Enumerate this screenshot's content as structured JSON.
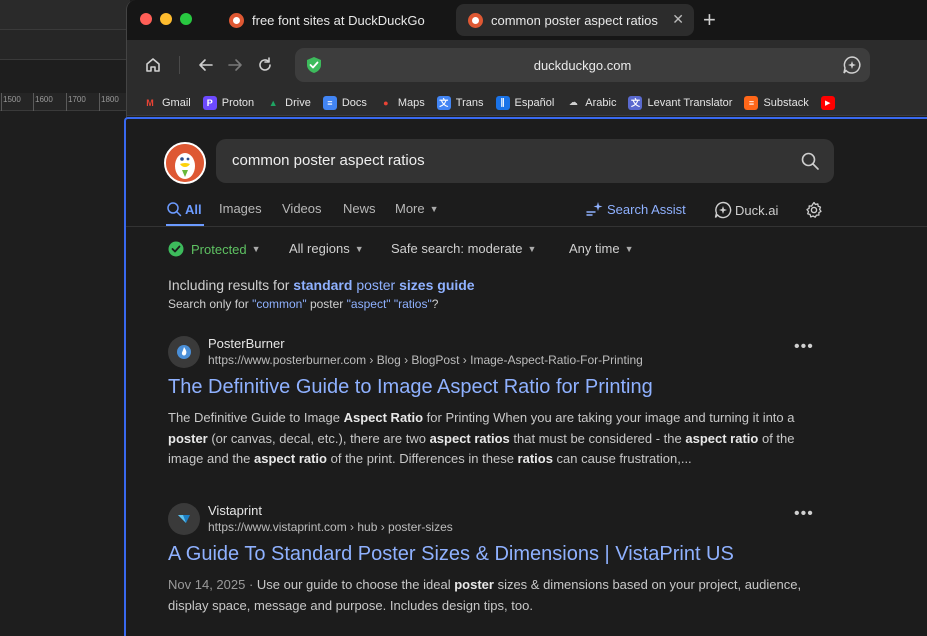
{
  "ruler": {
    "ticks": [
      "1500",
      "1600",
      "1700",
      "1800"
    ]
  },
  "tabs": [
    {
      "label": "free font sites at DuckDuckGo",
      "active": false
    },
    {
      "label": "common poster aspect ratios",
      "active": true
    }
  ],
  "address_bar": {
    "url": "duckduckgo.com"
  },
  "bookmarks": [
    {
      "label": "Gmail",
      "icon": "gmail-icon",
      "color": "#ea4335",
      "glyph": "M"
    },
    {
      "label": "Proton",
      "icon": "proton-icon",
      "color": "#6d4aff",
      "glyph": "P"
    },
    {
      "label": "Drive",
      "icon": "drive-icon",
      "color": "#1fa463",
      "glyph": "▲"
    },
    {
      "label": "Docs",
      "icon": "docs-icon",
      "color": "#4285f4",
      "glyph": "≡"
    },
    {
      "label": "Maps",
      "icon": "maps-icon",
      "color": "#34a853",
      "glyph": "●"
    },
    {
      "label": "Trans",
      "icon": "translate-icon",
      "color": "#4285f4",
      "glyph": "文"
    },
    {
      "label": "Español",
      "icon": "spanishdict-icon",
      "color": "#1a73e8",
      "glyph": "∥"
    },
    {
      "label": "Arabic",
      "icon": "arabic-icon",
      "color": "#777777",
      "glyph": "☁"
    },
    {
      "label": "Levant Translator",
      "icon": "levant-icon",
      "color": "#5a6acf",
      "glyph": "文"
    },
    {
      "label": "Substack",
      "icon": "substack-icon",
      "color": "#ff6719",
      "glyph": "≡"
    },
    {
      "label": "",
      "icon": "youtube-icon",
      "color": "#ff0000",
      "glyph": "▶"
    }
  ],
  "search": {
    "query": "common poster aspect ratios"
  },
  "nav": {
    "all": "All",
    "images": "Images",
    "videos": "Videos",
    "news": "News",
    "more": "More",
    "search_assist": "Search Assist",
    "duck_ai": "Duck.ai"
  },
  "filters": {
    "protected": "Protected",
    "region": "All regions",
    "safe_search": "Safe search: moderate",
    "time": "Any time"
  },
  "correction": {
    "prefix": "Including results for",
    "term_1": "standard",
    "term_2": "poster",
    "term_3": "sizes guide",
    "search_only_prefix": "Search only for",
    "q1": "\"common\"",
    "q2": "poster",
    "q3": "\"aspect\"",
    "q4": "\"ratios\"",
    "suffix": "?"
  },
  "results": [
    {
      "site": "PosterBurner",
      "url": "https://www.posterburner.com › Blog › BlogPost › Image-Aspect-Ratio-For-Printing",
      "title": "The Definitive Guide to Image Aspect Ratio for Printing",
      "snippet_parts": [
        "The Definitive Guide to Image ",
        "Aspect Ratio",
        " for Printing When you are taking your image and turning it into a ",
        "poster",
        " (or canvas, decal, etc.), there are two ",
        "aspect ratios",
        " that must be considered - the ",
        "aspect ratio",
        " of the image and the ",
        "aspect ratio",
        " of the print. Differences in these ",
        "ratios",
        " can cause frustration,..."
      ]
    },
    {
      "site": "Vistaprint",
      "url": "https://www.vistaprint.com › hub › poster-sizes",
      "title": "A Guide To Standard Poster Sizes & Dimensions | VistaPrint US",
      "date": "Nov 14, 2025",
      "snippet_parts": [
        "Use our guide to choose the ideal ",
        "poster",
        " sizes & dimensions based on your project, audience, display space, message and purpose. Includes design tips, too."
      ]
    }
  ],
  "more_glyph": "•••",
  "colors": {
    "accent": "#3969ef",
    "link": "#8fb1ff",
    "protected": "#5ec162",
    "ddg_orange": "#de5833"
  }
}
